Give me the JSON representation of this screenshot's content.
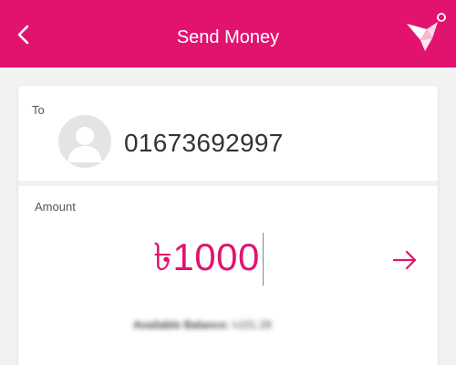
{
  "header": {
    "title": "Send Money",
    "bg_color": "#e2136e",
    "back_icon": "chevron-left-icon",
    "logo_icon": "origami-bird-logo"
  },
  "recipient": {
    "label": "To",
    "number": "01673692997",
    "avatar_icon": "person-avatar-icon"
  },
  "amount": {
    "label": "Amount",
    "value": "৳1000",
    "next_icon": "arrow-right-icon"
  },
  "balance": {
    "label": "Available Balance:",
    "value": "৳101.28"
  }
}
